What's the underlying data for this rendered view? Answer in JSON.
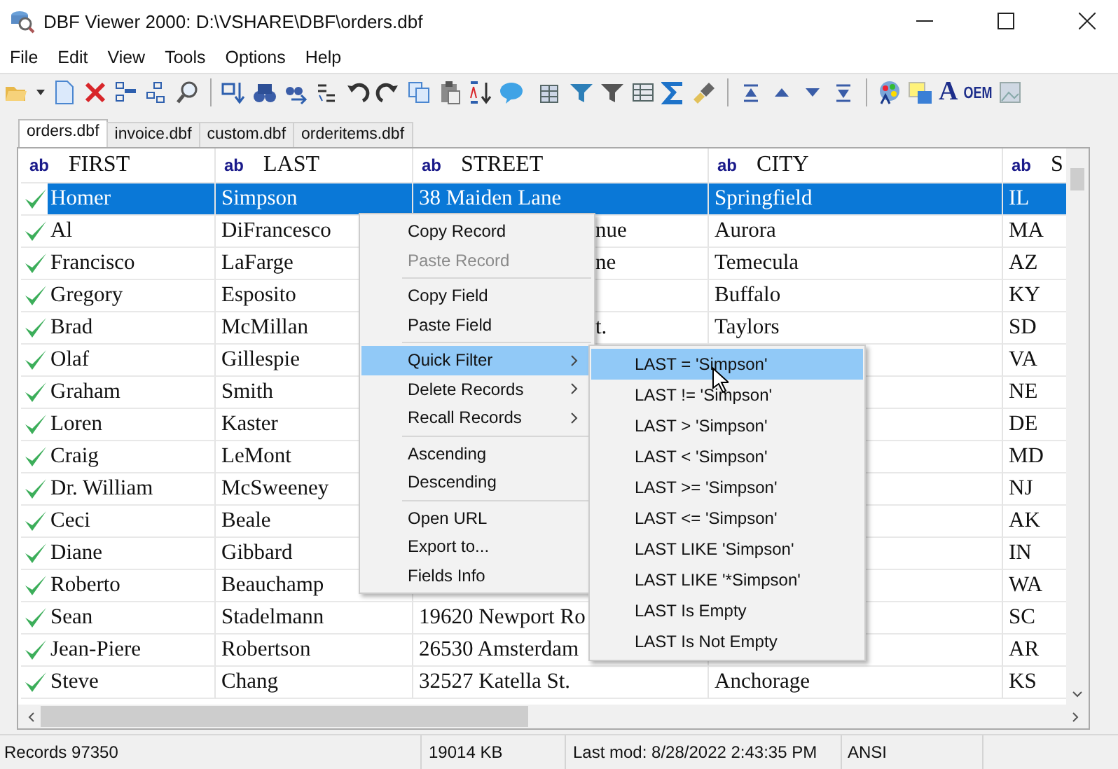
{
  "window": {
    "title": "DBF Viewer 2000: D:\\VSHARE\\DBF\\orders.dbf"
  },
  "menu_bar": [
    "File",
    "Edit",
    "View",
    "Tools",
    "Options",
    "Help"
  ],
  "toolbar": {
    "font_label": "A",
    "oem_label": "OEM"
  },
  "tabs": [
    {
      "label": "orders.dbf",
      "selected": true
    },
    {
      "label": "invoice.dbf",
      "selected": false
    },
    {
      "label": "custom.dbf",
      "selected": false
    },
    {
      "label": "orderitems.dbf",
      "selected": false
    }
  ],
  "table": {
    "columns": [
      {
        "type": "ab",
        "name": "FIRST"
      },
      {
        "type": "ab",
        "name": "LAST"
      },
      {
        "type": "ab",
        "name": "STREET"
      },
      {
        "type": "ab",
        "name": "CITY"
      },
      {
        "type": "ab",
        "name": "S"
      }
    ],
    "rows": [
      {
        "selected": true,
        "first": "Homer",
        "last": "Simpson",
        "street": "38 Maiden Lane",
        "city": "Springfield",
        "state": "IL"
      },
      {
        "selected": false,
        "first": "Al",
        "last": "DiFrancesco",
        "street": "nue",
        "city": "Aurora",
        "state": "MA"
      },
      {
        "selected": false,
        "first": "Francisco",
        "last": "LaFarge",
        "street": "ne",
        "city": "Temecula",
        "state": "AZ"
      },
      {
        "selected": false,
        "first": "Gregory",
        "last": "Esposito",
        "city": "Buffalo",
        "state": "KY"
      },
      {
        "selected": false,
        "first": "Brad",
        "last": "McMillan",
        "street": "t.",
        "city": "Taylors",
        "state": "SD"
      },
      {
        "selected": false,
        "first": "Olaf",
        "last": "Gillespie",
        "state": "VA"
      },
      {
        "selected": false,
        "first": "Graham",
        "last": "Smith",
        "state": "NE"
      },
      {
        "selected": false,
        "first": "Loren",
        "last": "Kaster",
        "state": "DE"
      },
      {
        "selected": false,
        "first": "Craig",
        "last": "LeMont",
        "state": "MD"
      },
      {
        "selected": false,
        "first": "Dr. William",
        "last": "McSweeney",
        "state": "NJ"
      },
      {
        "selected": false,
        "first": "Ceci",
        "last": "Beale",
        "state": "AK"
      },
      {
        "selected": false,
        "first": "Diane",
        "last": "Gibbard",
        "state": "IN"
      },
      {
        "selected": false,
        "first": "Roberto",
        "last": "Beauchamp",
        "state": "WA"
      },
      {
        "selected": false,
        "first": "Sean",
        "last": "Stadelmann",
        "street": "19620 Newport Ro",
        "state": "SC"
      },
      {
        "selected": false,
        "first": "Jean-Piere",
        "last": "Robertson",
        "street": "26530 Amsterdam",
        "state": "AR"
      },
      {
        "selected": false,
        "first": "Steve",
        "last": "Chang",
        "street": "32527 Katella St.",
        "city": "Anchorage",
        "state": "KS"
      }
    ]
  },
  "context_menu": [
    {
      "kind": "item",
      "label": "Copy Record",
      "disabled": false,
      "selected": false,
      "submenu": false
    },
    {
      "kind": "item",
      "label": "Paste Record",
      "disabled": true,
      "selected": false,
      "submenu": false
    },
    {
      "kind": "separator"
    },
    {
      "kind": "item",
      "label": "Copy Field",
      "disabled": false,
      "selected": false,
      "submenu": false
    },
    {
      "kind": "item",
      "label": "Paste Field",
      "disabled": false,
      "selected": false,
      "submenu": false
    },
    {
      "kind": "separator"
    },
    {
      "kind": "item",
      "label": "Quick Filter",
      "disabled": false,
      "selected": true,
      "submenu": true
    },
    {
      "kind": "item",
      "label": "Delete Records",
      "disabled": false,
      "selected": false,
      "submenu": true
    },
    {
      "kind": "item",
      "label": "Recall Records",
      "disabled": false,
      "selected": false,
      "submenu": true
    },
    {
      "kind": "separator"
    },
    {
      "kind": "item",
      "label": "Ascending",
      "disabled": false,
      "selected": false,
      "submenu": false
    },
    {
      "kind": "item",
      "label": "Descending",
      "disabled": false,
      "selected": false,
      "submenu": false
    },
    {
      "kind": "separator"
    },
    {
      "kind": "item",
      "label": "Open URL",
      "disabled": false,
      "selected": false,
      "submenu": false
    },
    {
      "kind": "item",
      "label": "Export to...",
      "disabled": false,
      "selected": false,
      "submenu": false
    },
    {
      "kind": "item",
      "label": "Fields Info",
      "disabled": false,
      "selected": false,
      "submenu": false
    }
  ],
  "quick_filter_menu": [
    {
      "label": "LAST = 'Simpson'",
      "selected": true
    },
    {
      "label": "LAST != 'Simpson'",
      "selected": false
    },
    {
      "label": "LAST > 'Simpson'",
      "selected": false
    },
    {
      "label": "LAST < 'Simpson'",
      "selected": false
    },
    {
      "label": "LAST >= 'Simpson'",
      "selected": false
    },
    {
      "label": "LAST <= 'Simpson'",
      "selected": false
    },
    {
      "label": "LAST LIKE 'Simpson'",
      "selected": false
    },
    {
      "label": "LAST LIKE '*Simpson'",
      "selected": false
    },
    {
      "label": "LAST Is Empty",
      "selected": false
    },
    {
      "label": "LAST Is Not Empty",
      "selected": false
    }
  ],
  "status_bar": [
    "Records 97350",
    "19014 KB",
    "Last mod: 8/28/2022 2:43:35 PM",
    "ANSI"
  ]
}
